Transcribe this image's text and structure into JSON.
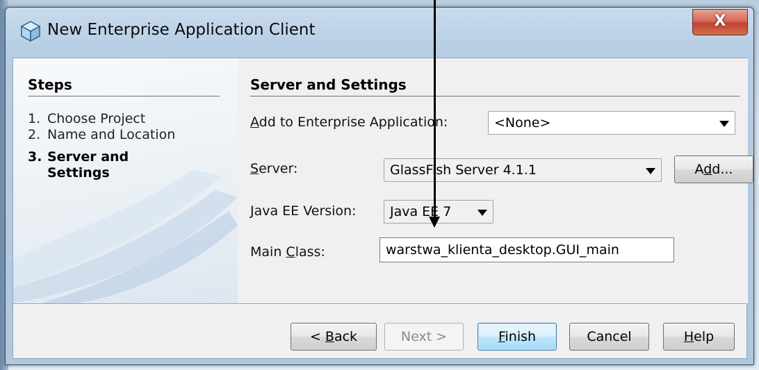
{
  "window": {
    "title": "New Enterprise Application Client",
    "close_glyph": "X"
  },
  "steps": {
    "heading": "Steps",
    "items": [
      {
        "num": "1.",
        "label": "Choose Project",
        "current": false
      },
      {
        "num": "2.",
        "label": "Name and Location",
        "current": false
      },
      {
        "num": "3.",
        "label_line1": "Server and",
        "label_line2": "Settings",
        "current": true
      }
    ]
  },
  "content": {
    "heading": "Server and Settings",
    "enterprise_app": {
      "label_mnemonic": "A",
      "label_rest": "dd to Enterprise Application:",
      "value": "<None>"
    },
    "server": {
      "label_mnemonic": "S",
      "label_rest": "erver:",
      "value": "GlassFish Server 4.1.1"
    },
    "add_button": {
      "pre": "A",
      "mnemonic": "d",
      "post": "d..."
    },
    "java_ee": {
      "label_mnemonic": "J",
      "label_rest": "ava EE Version:",
      "value": "Java EE 7"
    },
    "main_class": {
      "label_pre": "Main ",
      "label_mnemonic": "C",
      "label_rest": "lass:",
      "value": "warstwa_klienta_desktop.GUI_main"
    }
  },
  "buttons": {
    "back": {
      "pre": "< ",
      "mnemonic": "B",
      "post": "ack"
    },
    "next": {
      "label": "Next >"
    },
    "finish": {
      "mnemonic": "F",
      "post": "inish"
    },
    "cancel": {
      "label": "Cancel"
    },
    "help": {
      "mnemonic": "H",
      "post": "elp"
    }
  },
  "colors": {
    "default_button_border": "#3c7fb1",
    "close_button": "#c24332",
    "title_bar": "#b6cde4"
  }
}
